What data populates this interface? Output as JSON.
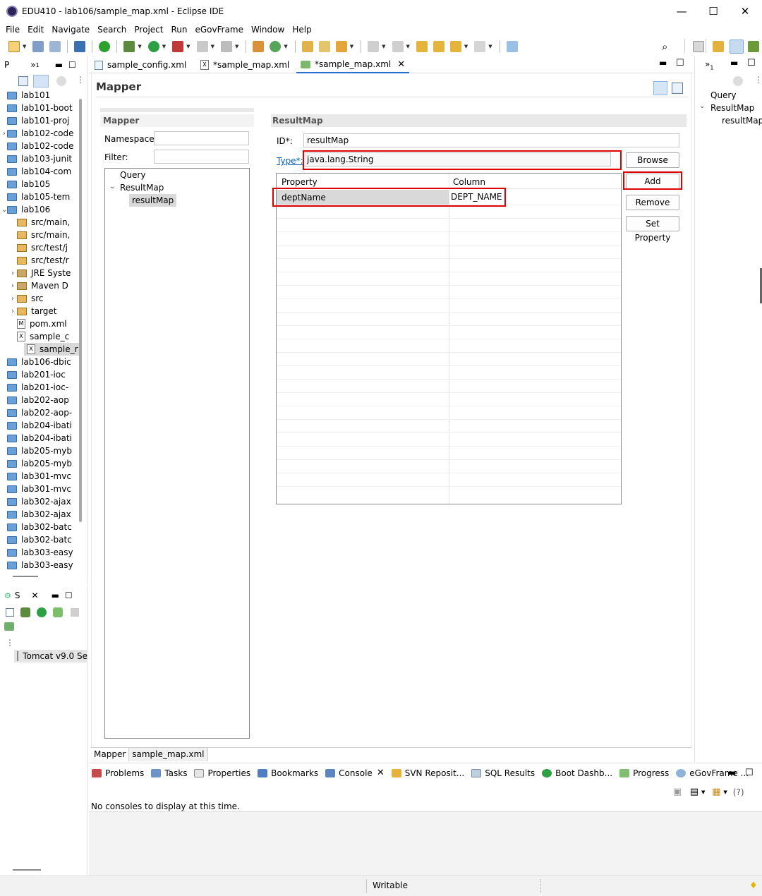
{
  "window": {
    "title": "EDU410 - lab106/sample_map.xml - Eclipse IDE",
    "minimize": "—",
    "maximize": "☐",
    "close": "✕"
  },
  "menu": [
    "File",
    "Edit",
    "Navigate",
    "Search",
    "Project",
    "Run",
    "eGovFrame",
    "Window",
    "Help"
  ],
  "left_view": {
    "tab_label": "P",
    "overflow": "»",
    "overflow_count": "1",
    "items": [
      {
        "label": "lab101",
        "icon": "folder",
        "indent": 0,
        "chevron": ""
      },
      {
        "label": "lab101-boot",
        "icon": "folder",
        "indent": 0,
        "chevron": ""
      },
      {
        "label": "lab101-proj",
        "icon": "folder",
        "indent": 0,
        "chevron": ""
      },
      {
        "label": "lab102-code",
        "icon": "folder",
        "indent": 0,
        "chevron": ">"
      },
      {
        "label": "lab102-code",
        "icon": "folder",
        "indent": 0,
        "chevron": ""
      },
      {
        "label": "lab103-junit",
        "icon": "folder",
        "indent": 0,
        "chevron": ""
      },
      {
        "label": "lab104-com",
        "icon": "folder",
        "indent": 0,
        "chevron": ""
      },
      {
        "label": "lab105",
        "icon": "folder",
        "indent": 0,
        "chevron": ""
      },
      {
        "label": "lab105-tem",
        "icon": "folder",
        "indent": 0,
        "chevron": ""
      },
      {
        "label": "lab106",
        "icon": "folder",
        "indent": 0,
        "chevron": "v"
      },
      {
        "label": "src/main,",
        "icon": "pkg",
        "indent": 1,
        "chevron": ""
      },
      {
        "label": "src/main,",
        "icon": "pkg",
        "indent": 1,
        "chevron": ""
      },
      {
        "label": "src/test/j",
        "icon": "pkg",
        "indent": 1,
        "chevron": ""
      },
      {
        "label": "src/test/r",
        "icon": "pkg",
        "indent": 1,
        "chevron": ""
      },
      {
        "label": "JRE Syste",
        "icon": "lib",
        "indent": 1,
        "chevron": ">"
      },
      {
        "label": "Maven D",
        "icon": "lib",
        "indent": 1,
        "chevron": ">"
      },
      {
        "label": "src",
        "icon": "pkg",
        "indent": 1,
        "chevron": ">"
      },
      {
        "label": "target",
        "icon": "pkg",
        "indent": 1,
        "chevron": ">"
      },
      {
        "label": "pom.xml",
        "icon": "file-m",
        "indent": 1,
        "chevron": ""
      },
      {
        "label": "sample_c",
        "icon": "file-x",
        "indent": 1,
        "chevron": ""
      },
      {
        "label": "sample_r",
        "icon": "file-x",
        "indent": 1,
        "chevron": "",
        "selected": true
      },
      {
        "label": "lab106-dbic",
        "icon": "folder",
        "indent": 0,
        "chevron": ""
      },
      {
        "label": "lab201-ioc",
        "icon": "folder",
        "indent": 0,
        "chevron": ""
      },
      {
        "label": "lab201-ioc-",
        "icon": "folder",
        "indent": 0,
        "chevron": ""
      },
      {
        "label": "lab202-aop",
        "icon": "folder",
        "indent": 0,
        "chevron": ""
      },
      {
        "label": "lab202-aop-",
        "icon": "folder",
        "indent": 0,
        "chevron": ""
      },
      {
        "label": "lab204-ibati",
        "icon": "folder",
        "indent": 0,
        "chevron": ""
      },
      {
        "label": "lab204-ibati",
        "icon": "folder",
        "indent": 0,
        "chevron": ""
      },
      {
        "label": "lab205-myb",
        "icon": "folder",
        "indent": 0,
        "chevron": ""
      },
      {
        "label": "lab205-myb",
        "icon": "folder",
        "indent": 0,
        "chevron": ""
      },
      {
        "label": "lab301-mvc",
        "icon": "folder",
        "indent": 0,
        "chevron": ""
      },
      {
        "label": "lab301-mvc",
        "icon": "folder",
        "indent": 0,
        "chevron": ""
      },
      {
        "label": "lab302-ajax",
        "icon": "folder",
        "indent": 0,
        "chevron": ""
      },
      {
        "label": "lab302-ajax",
        "icon": "folder",
        "indent": 0,
        "chevron": ""
      },
      {
        "label": "lab302-batc",
        "icon": "folder",
        "indent": 0,
        "chevron": ""
      },
      {
        "label": "lab302-batc",
        "icon": "folder",
        "indent": 0,
        "chevron": ""
      },
      {
        "label": "lab303-easy",
        "icon": "folder",
        "indent": 0,
        "chevron": ""
      },
      {
        "label": "lab303-easy",
        "icon": "folder",
        "indent": 0,
        "chevron": ""
      }
    ]
  },
  "servers_view": {
    "tab_label": "S",
    "server": "Tomcat v9.0 Se"
  },
  "editor_tabs": [
    {
      "label": "sample_config.xml",
      "active": false
    },
    {
      "label": "*sample_map.xml",
      "active": false
    },
    {
      "label": "*sample_map.xml",
      "active": true
    }
  ],
  "editor": {
    "title": "Mapper",
    "left_section": {
      "header": "Mapper",
      "namespace_label": "Namespace:",
      "namespace_value": "",
      "filter_label": "Filter:",
      "filter_value": "",
      "tree": [
        "Query",
        "ResultMap",
        "resultMap"
      ]
    },
    "right_section": {
      "header": "ResultMap",
      "id_label": "ID*:",
      "id_value": "resultMap",
      "type_label": "Type*:",
      "type_value": "java.lang.String",
      "browse_button": "Browse",
      "table": {
        "columns": [
          "Property",
          "Column"
        ],
        "rows": [
          {
            "property": "deptName",
            "column": "DEPT_NAME"
          }
        ]
      },
      "add_button": "Add",
      "remove_button": "Remove",
      "set_property_button": "Set Property"
    },
    "bottom_tabs": [
      "Mapper",
      "sample_map.xml"
    ]
  },
  "outline_view": {
    "overflow": "»",
    "overflow_count": "1",
    "tree": [
      "Query",
      "ResultMap",
      "resultMap"
    ]
  },
  "bottom_panel": {
    "tabs": [
      "Problems",
      "Tasks",
      "Properties",
      "Bookmarks",
      "Console",
      "SVN Reposit...",
      "SQL Results",
      "Boot Dashb...",
      "Progress",
      "eGovFrame ..."
    ],
    "active_tab": "Console",
    "message": "No consoles to display at this time."
  },
  "status_bar": {
    "writable": "Writable"
  },
  "colors": {
    "highlight_red": "#e00000",
    "link_blue": "#0b62b8",
    "selected_row": "#d9d9d9",
    "section_header": "#e8e8e8"
  }
}
